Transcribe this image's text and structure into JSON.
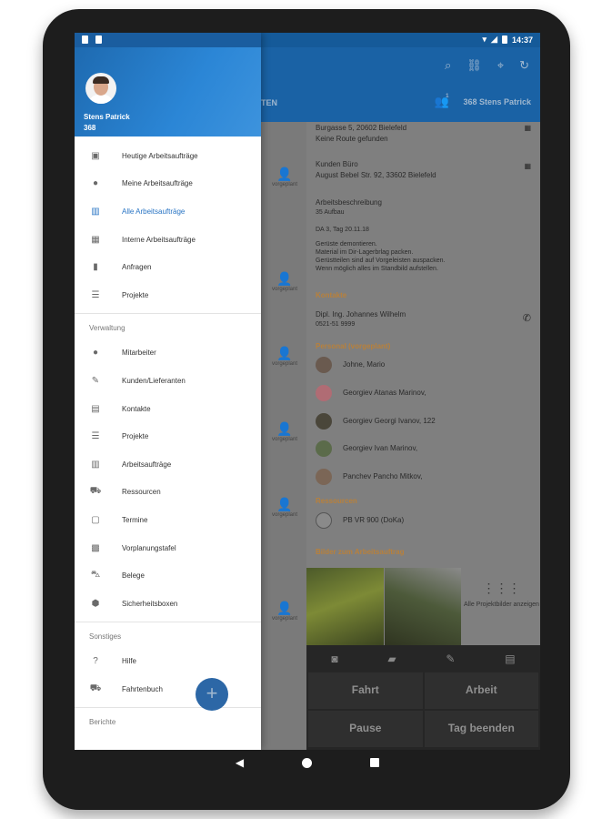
{
  "statusbar": {
    "time": "14:37"
  },
  "appbar": {
    "tab_fragment": "TEN",
    "staff_label": "368 Stens Patrick",
    "notification_count": "1"
  },
  "drawer": {
    "user_name": "Stens Patrick",
    "user_number": "368",
    "items_main": [
      {
        "label": "Heutige Arbeitsaufträge",
        "icon": "calendar-today-icon"
      },
      {
        "label": "Meine Arbeitsaufträge",
        "icon": "person-icon"
      },
      {
        "label": "Alle Arbeitsaufträge",
        "icon": "map-icon",
        "active": true
      },
      {
        "label": "Interne Arbeitsaufträge",
        "icon": "building-icon"
      },
      {
        "label": "Anfragen",
        "icon": "book-icon"
      },
      {
        "label": "Projekte",
        "icon": "list-icon"
      }
    ],
    "section_verwaltung": "Verwaltung",
    "items_verwaltung": [
      {
        "label": "Mitarbeiter",
        "icon": "person-icon"
      },
      {
        "label": "Kunden/Lieferanten",
        "icon": "person-edit-icon"
      },
      {
        "label": "Kontakte",
        "icon": "contacts-icon"
      },
      {
        "label": "Projekte",
        "icon": "list-icon"
      },
      {
        "label": "Arbeitsaufträge",
        "icon": "map-icon"
      },
      {
        "label": "Ressourcen",
        "icon": "car-icon"
      },
      {
        "label": "Termine",
        "icon": "calendar-icon"
      },
      {
        "label": "Vorplanungstafel",
        "icon": "planner-icon"
      },
      {
        "label": "Belege",
        "icon": "cart-icon"
      },
      {
        "label": "Sicherheitsboxen",
        "icon": "box-icon"
      }
    ],
    "section_sonstiges": "Sonstiges",
    "items_sonstiges": [
      {
        "label": "Hilfe",
        "icon": "help-icon"
      },
      {
        "label": "Fahrtenbuch",
        "icon": "car-icon"
      }
    ],
    "section_berichte": "Berichte"
  },
  "cards": [
    {
      "status": "vorgeplant"
    },
    {
      "status": "vorgeplant"
    },
    {
      "status": "vorgeplant"
    },
    {
      "status": "vorgeplant"
    },
    {
      "status": "vorgeplant"
    },
    {
      "status": "vorgeplant"
    }
  ],
  "detail": {
    "address_top": "Burgasse 5, 20602 Bielefeld",
    "address_top_note": "Keine Route gefunden",
    "office_title": "Kunden Büro",
    "office_address": "August Bebel Str. 92, 33602 Bielefeld",
    "work_desc_title": "Arbeitsbeschreibung",
    "work_desc_sub": "35 Aufbau",
    "work_day": "DA 3, Tag 20.11.18",
    "work_lines": [
      "Gerüste demontieren.",
      "Material im Dir-Lagerbrlag packen.",
      "Gerüstteilen sind auf Vorgeleisten auspacken.",
      "Wenn möglich alles im Standbild aufstellen."
    ],
    "section_contacts": "Kontakte",
    "contact_name": "Dipl. Ing. Johannes Wilhelm",
    "contact_phone": "0521-51 9999",
    "section_persons": "Personal (vorgeplant)",
    "persons": [
      "Johne, Mario",
      "Georgiev Atanas Marinov,",
      "Georgiev Georgi Ivanov, 122",
      "Georgiev Ivan Marinov,",
      "Panchev Pancho Mitkov,"
    ],
    "section_resources": "Ressourcen",
    "resource": "PB VR 900 (DoKa)",
    "section_images": "Bilder zum Arbeitsauftrag",
    "images_more": "Alle Projektbilder anzeigen"
  },
  "bottom": {
    "fahrt": "Fahrt",
    "arbeit": "Arbeit",
    "pause": "Pause",
    "tag_beenden": "Tag beenden"
  }
}
